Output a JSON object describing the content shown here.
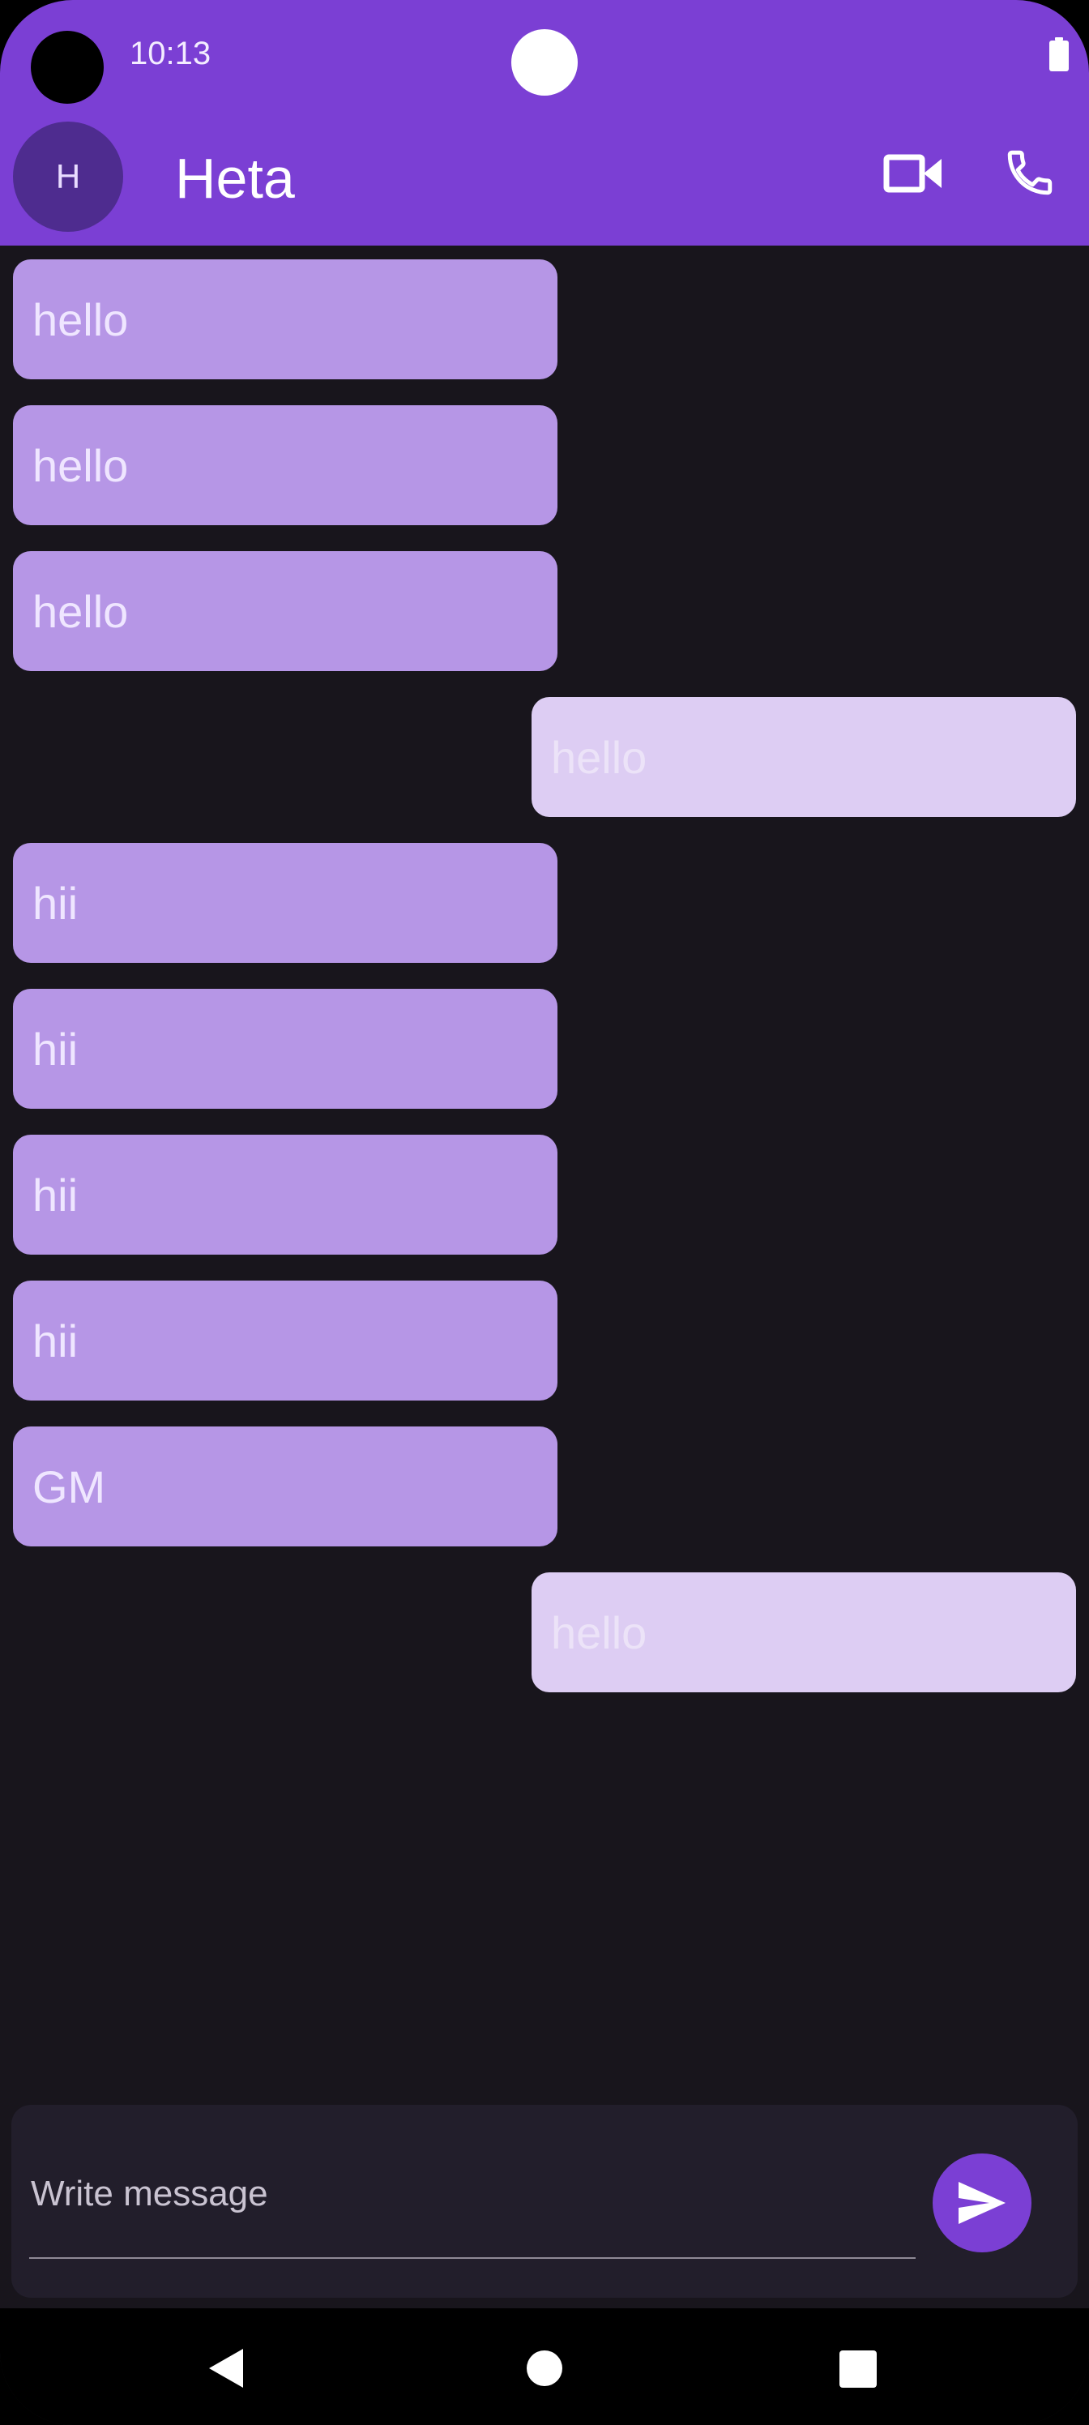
{
  "status_bar": {
    "time": "10:13"
  },
  "header": {
    "avatar_initial": "H",
    "contact_name": "Heta",
    "actions": [
      {
        "icon": "video-call-icon"
      },
      {
        "icon": "phone-call-icon"
      }
    ]
  },
  "messages": [
    {
      "text": "hello",
      "direction": "incoming"
    },
    {
      "text": "hello",
      "direction": "incoming"
    },
    {
      "text": "hello",
      "direction": "incoming"
    },
    {
      "text": "hello",
      "direction": "outgoing"
    },
    {
      "text": "hii",
      "direction": "incoming"
    },
    {
      "text": "hii",
      "direction": "incoming"
    },
    {
      "text": "hii",
      "direction": "incoming"
    },
    {
      "text": "hii",
      "direction": "incoming"
    },
    {
      "text": "GM",
      "direction": "incoming"
    },
    {
      "text": "hello",
      "direction": "outgoing"
    }
  ],
  "composer": {
    "placeholder": "Write message",
    "value": ""
  },
  "colors": {
    "primary": "#7b3fd4",
    "background": "#18151c",
    "incoming_bubble": "#b696e6",
    "outgoing_bubble": "#ddcdf3"
  }
}
